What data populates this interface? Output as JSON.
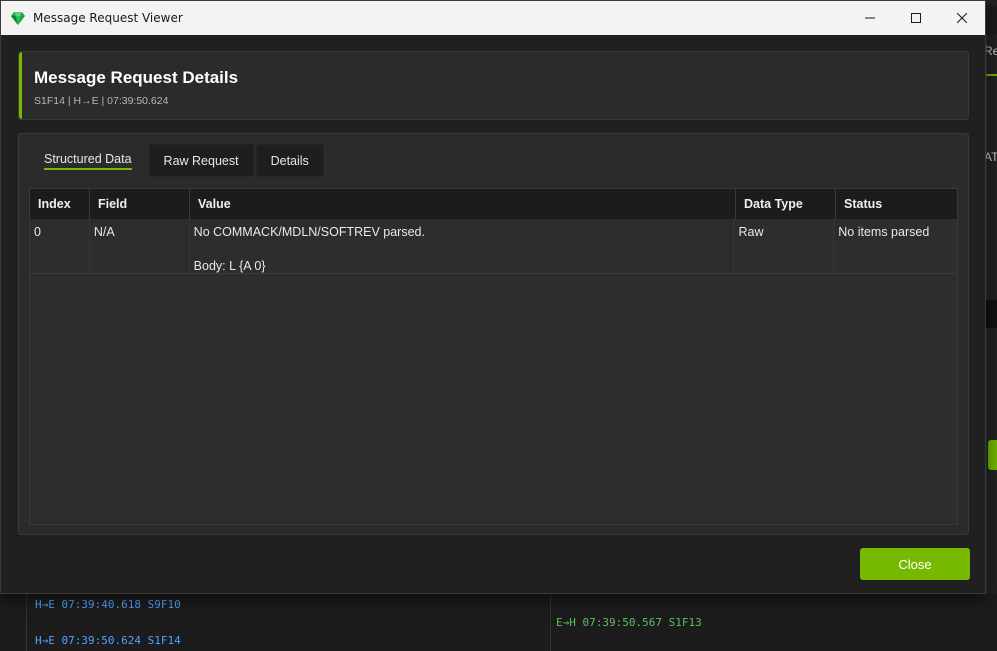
{
  "window": {
    "title": "Message Request Viewer",
    "controls": [
      "minimize",
      "maximize",
      "close"
    ]
  },
  "header": {
    "title": "Message Request Details",
    "subtitle": "S1F14 | H→E | 07:39:50.624"
  },
  "tabs": [
    {
      "label": "Structured Data",
      "active": true
    },
    {
      "label": "Raw Request",
      "active": false
    },
    {
      "label": "Details",
      "active": false
    }
  ],
  "grid": {
    "columns": [
      "Index",
      "Field",
      "Value",
      "Data Type",
      "Status"
    ],
    "rows": [
      {
        "index": "0",
        "field": "N/A",
        "value": "No COMMACK/MDLN/SOFTREV parsed.\n\nBody: L {A 0}",
        "data_type": "Raw",
        "status": "No items parsed"
      }
    ]
  },
  "footer": {
    "close_label": "Close"
  },
  "background_app": {
    "right_text_1": "Re",
    "right_text_2": "AT",
    "log_left": [
      {
        "text": "H→E 07:39:40.618 S9F10"
      },
      {
        "text": "H→E 07:39:50.624 S1F14"
      }
    ],
    "log_right": [
      {
        "text": "E→H 07:39:50.567 S1F13"
      }
    ]
  },
  "colors": {
    "accent": "#76b900",
    "host_to_equipment": "#4ea3ff",
    "equipment_to_host": "#5fbf5f"
  }
}
